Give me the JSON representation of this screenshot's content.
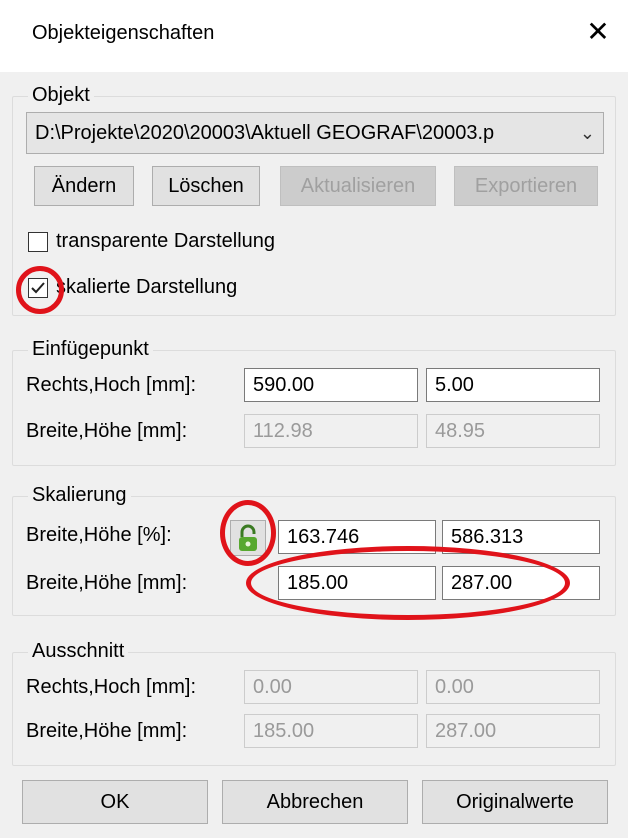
{
  "window": {
    "title": "Objekteigenschaften",
    "close_icon": "close-icon"
  },
  "objekt": {
    "legend": "Objekt",
    "path_value": "D:\\Projekte\\2020\\20003\\Aktuell GEOGRAF\\20003.p",
    "buttons": {
      "aendern": "Ändern",
      "loeschen": "Löschen",
      "aktualisieren": "Aktualisieren",
      "exportieren": "Exportieren"
    },
    "transparent": {
      "label": "transparente Darstellung",
      "checked": false
    },
    "skaliert": {
      "label": "skalierte Darstellung",
      "checked": true
    }
  },
  "einfuegepunkt": {
    "legend": "Einfügepunkt",
    "row1_label": "Rechts,Hoch [mm]:",
    "rechts": "590.00",
    "hoch": "5.00",
    "row2_label": "Breite,Höhe [mm]:",
    "breite": "112.98",
    "hoehe": "48.95"
  },
  "skalierung": {
    "legend": "Skalierung",
    "row1_label": "Breite,Höhe [%]:",
    "breite_pct": "163.746",
    "hoehe_pct": "586.313",
    "row2_label": "Breite,Höhe [mm]:",
    "breite_mm": "185.00",
    "hoehe_mm": "287.00",
    "lock_icon": "lock-open-icon"
  },
  "ausschnitt": {
    "legend": "Ausschnitt",
    "row1_label": "Rechts,Hoch [mm]:",
    "rechts": "0.00",
    "hoch": "0.00",
    "row2_label": "Breite,Höhe [mm]:",
    "breite": "185.00",
    "hoehe": "287.00"
  },
  "footer": {
    "ok": "OK",
    "abbrechen": "Abbrechen",
    "originalwerte": "Originalwerte"
  },
  "colors": {
    "annotation_red": "#e0131a"
  }
}
